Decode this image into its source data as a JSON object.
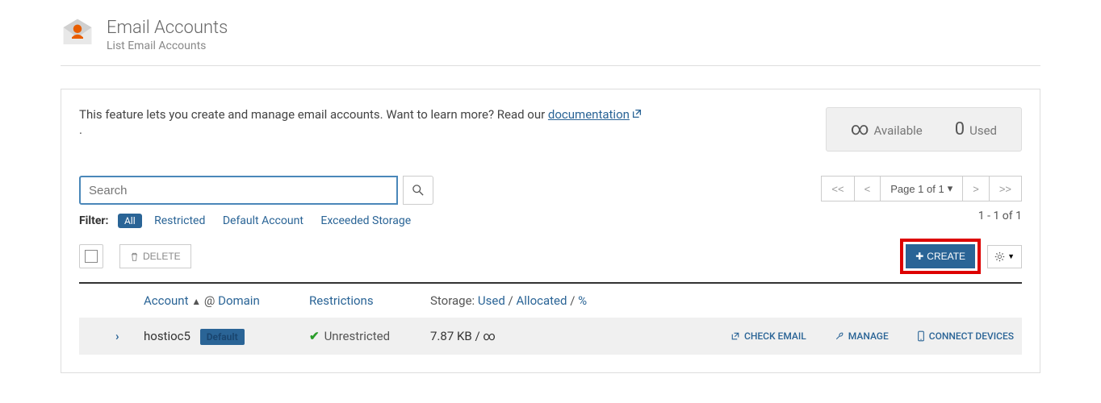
{
  "header": {
    "title": "Email Accounts",
    "subtitle": "List Email Accounts"
  },
  "intro": {
    "text_before": "This feature lets you create and manage email accounts. Want to learn more? Read our ",
    "link": "documentation",
    "text_after": "."
  },
  "stats": {
    "available_symbol": "∞",
    "available_label": "Available",
    "used_value": "0",
    "used_label": "Used"
  },
  "search": {
    "placeholder": "Search"
  },
  "filter": {
    "label": "Filter:",
    "all": "All",
    "restricted": "Restricted",
    "default_account": "Default Account",
    "exceeded": "Exceeded Storage"
  },
  "pager": {
    "first": "<<",
    "prev": "<",
    "info": "Page 1 of 1",
    "next": ">",
    "last": ">>"
  },
  "result_count": "1 - 1 of 1",
  "actions": {
    "delete": "DELETE",
    "create": "CREATE"
  },
  "columns": {
    "account": "Account",
    "at": "@",
    "domain": "Domain",
    "restrictions": "Restrictions",
    "storage_label": "Storage:",
    "used": "Used",
    "allocated": "Allocated",
    "percent": "%"
  },
  "row": {
    "account": "hostioc5",
    "badge": "Default",
    "restriction": "Unrestricted",
    "storage": "7.87 KB / ∞",
    "check_email": "CHECK EMAIL",
    "manage": "MANAGE",
    "connect": "CONNECT DEVICES"
  }
}
